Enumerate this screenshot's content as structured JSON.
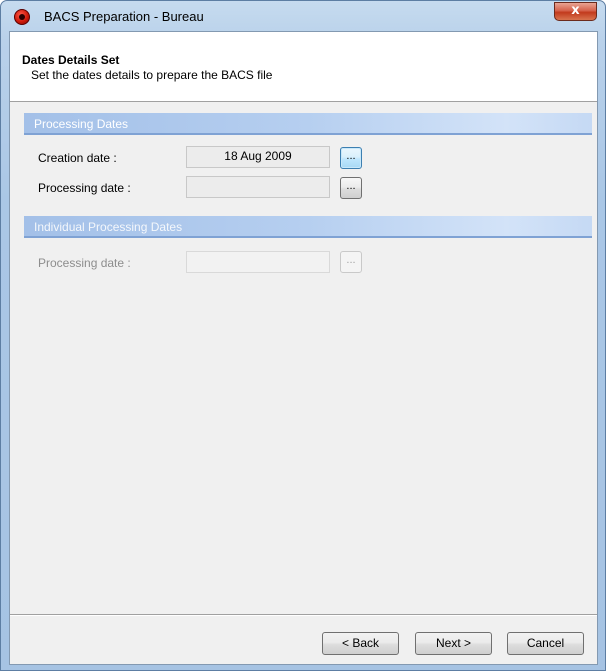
{
  "window": {
    "title": "BACS Preparation - Bureau",
    "close_glyph": "x",
    "icon": "bacs-app-icon"
  },
  "header": {
    "title": "Dates Details Set",
    "subtitle": "Set the dates details to prepare the BACS file"
  },
  "processing_dates": {
    "section_title": "Processing Dates",
    "creation_label": "Creation date :",
    "creation_value": "18 Aug 2009",
    "processing_label": "Processing date :",
    "processing_value": "",
    "browse_glyph": "..."
  },
  "individual_dates": {
    "section_title": "Individual Processing Dates",
    "processing_label": "Processing date :",
    "processing_value": "",
    "browse_glyph": "..."
  },
  "footer": {
    "back_label": "< Back",
    "next_label": "Next >",
    "cancel_label": "Cancel"
  },
  "colors": {
    "frame": "#a6c3e3",
    "section_bar": "#b6cff0",
    "close_button": "#c23a1d",
    "client_bg": "#f0f0f0"
  }
}
